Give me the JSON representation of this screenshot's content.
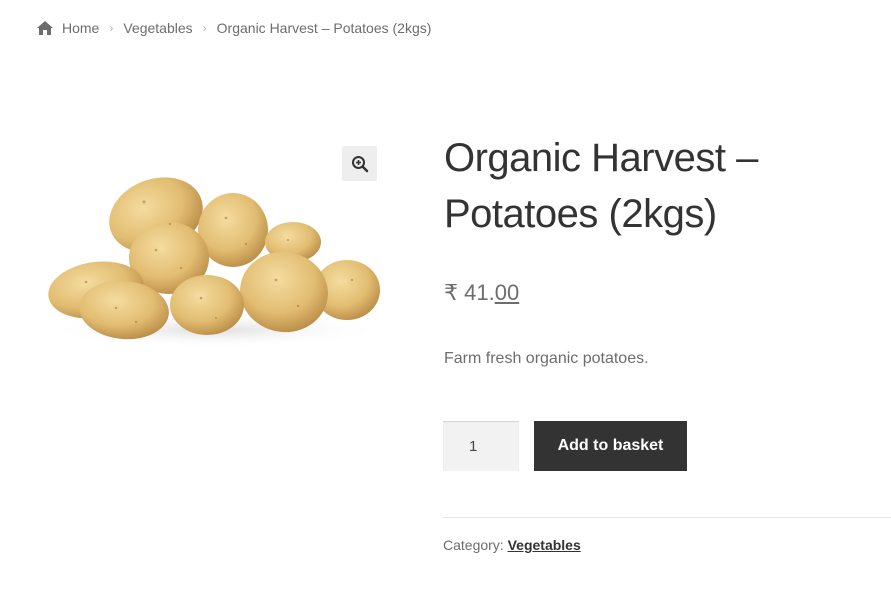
{
  "breadcrumb": {
    "home_icon": "home-icon",
    "home": "Home",
    "category": "Vegetables",
    "current": "Organic Harvest – Potatoes (2kgs)",
    "separator_icon": "chevron-right-icon"
  },
  "gallery": {
    "zoom_icon": "zoom-in-icon"
  },
  "product": {
    "title": "Organic Harvest – Potatoes (2kgs)",
    "price_main": "₹ 41.",
    "price_cents": "00",
    "description": "Farm fresh organic potatoes."
  },
  "cart": {
    "quantity": "1",
    "add_button": "Add to basket"
  },
  "meta": {
    "category_label": "Category:",
    "category_link": "Vegetables"
  },
  "colors": {
    "button_bg": "#333333",
    "text": "#6d6d6d",
    "title": "#333333"
  }
}
